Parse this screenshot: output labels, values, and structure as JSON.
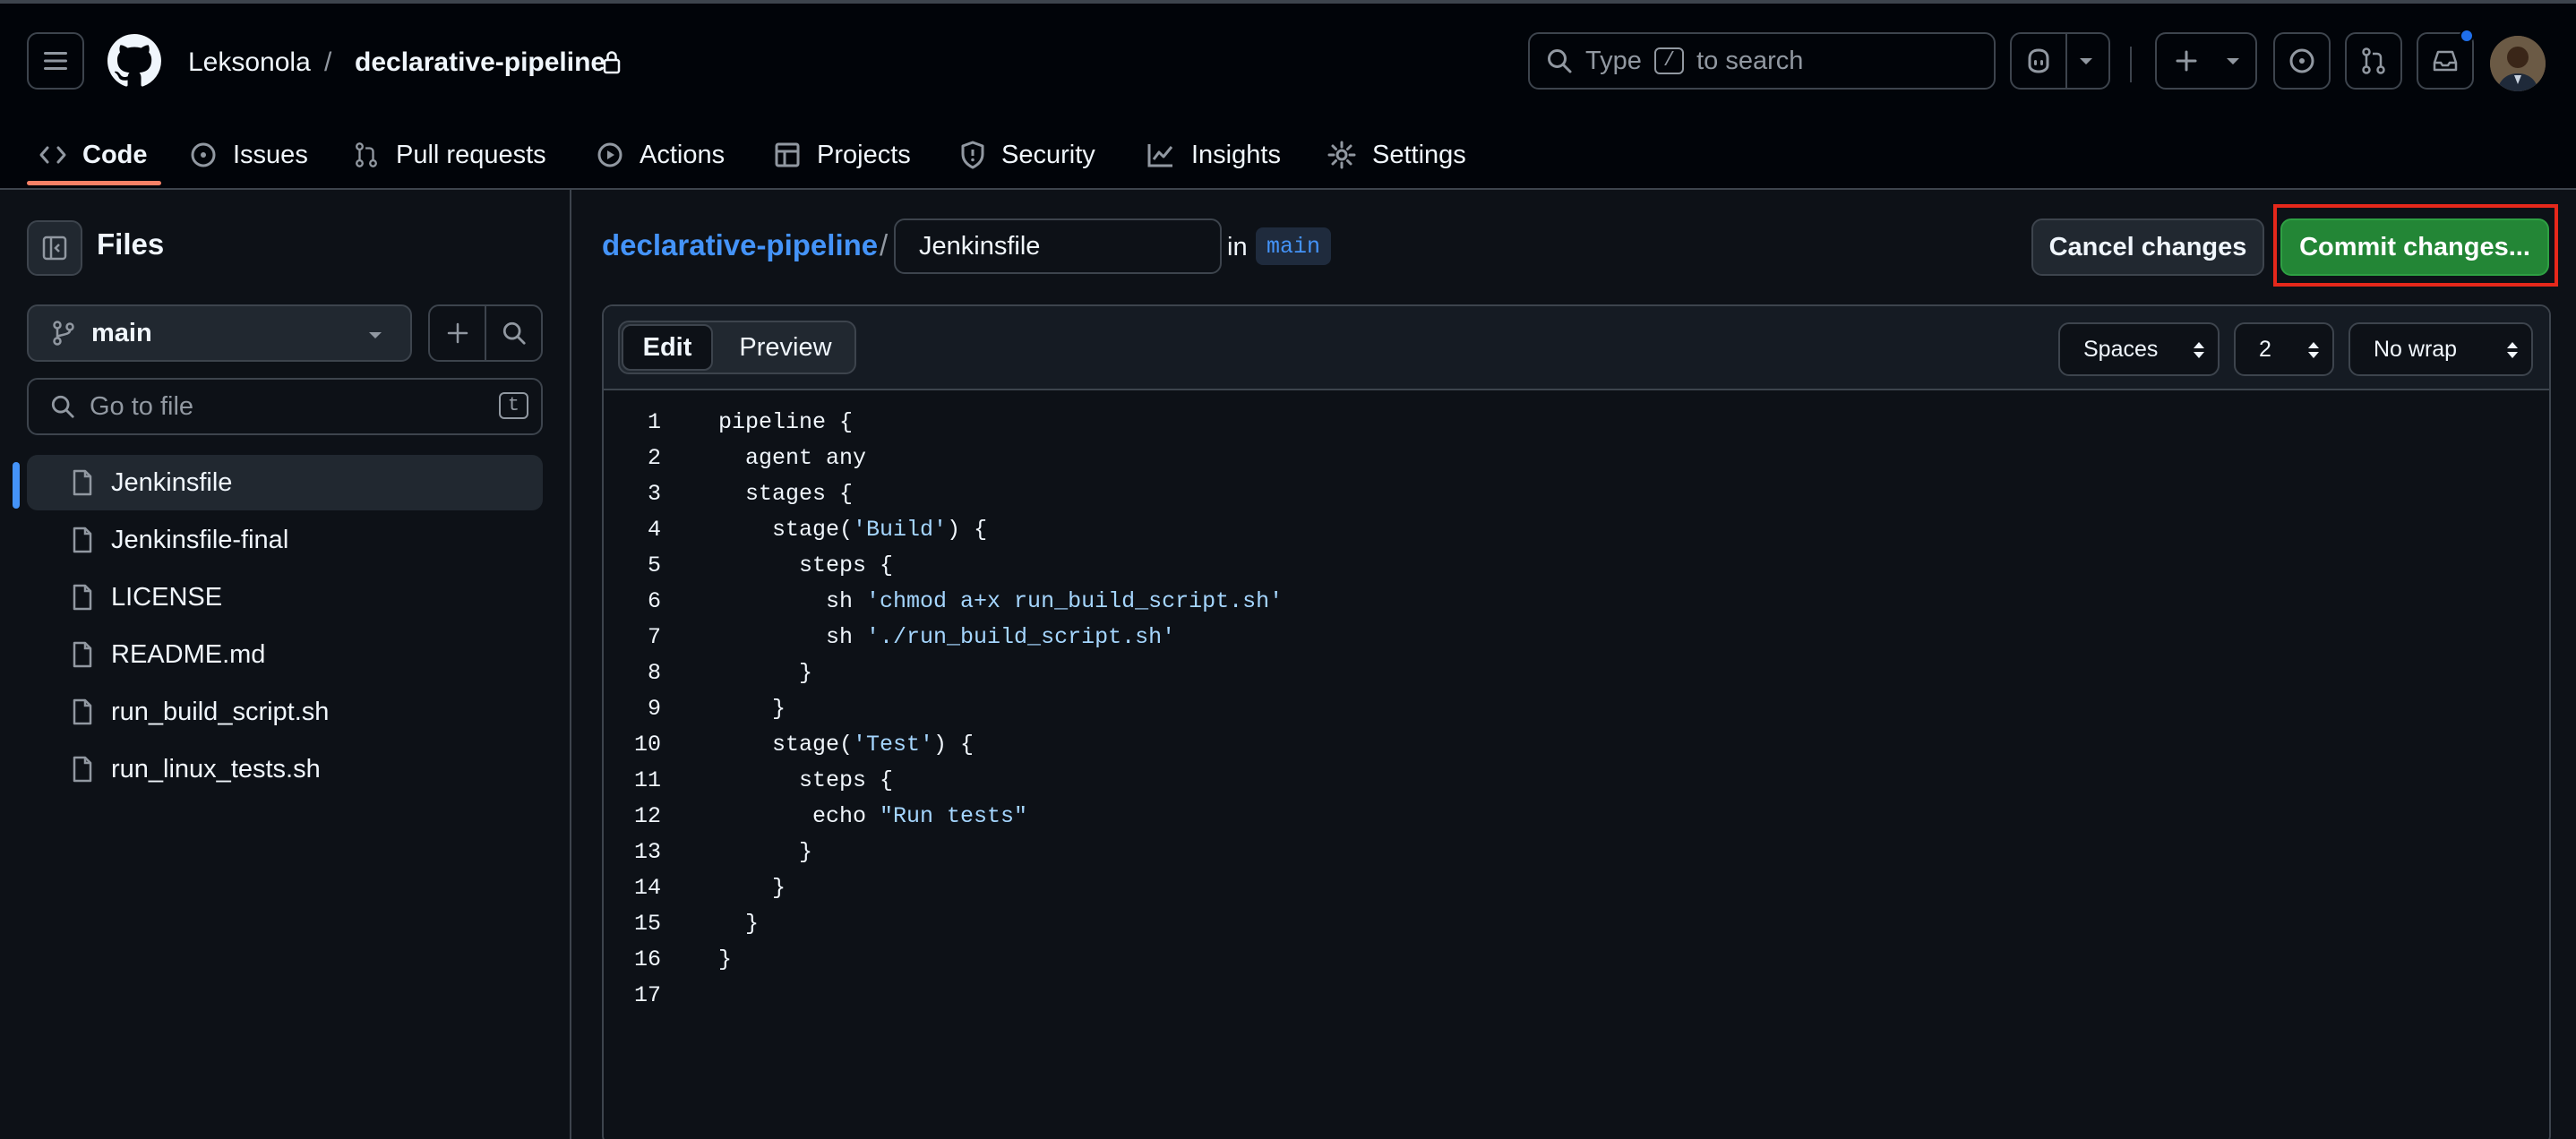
{
  "header": {
    "owner": "Leksonola",
    "separator": "/",
    "repo": "declarative-pipeline",
    "search_prefix": "Type",
    "search_key": "/",
    "search_suffix": "to search"
  },
  "tabs": [
    {
      "label": "Code",
      "icon": "code-icon"
    },
    {
      "label": "Issues",
      "icon": "issue-icon"
    },
    {
      "label": "Pull requests",
      "icon": "pull-request-icon"
    },
    {
      "label": "Actions",
      "icon": "play-icon"
    },
    {
      "label": "Projects",
      "icon": "table-icon"
    },
    {
      "label": "Security",
      "icon": "shield-icon"
    },
    {
      "label": "Insights",
      "icon": "graph-icon"
    },
    {
      "label": "Settings",
      "icon": "gear-icon"
    }
  ],
  "sidebar": {
    "title": "Files",
    "branch": "main",
    "goto_placeholder": "Go to file",
    "goto_key": "t",
    "files": [
      "Jenkinsfile",
      "Jenkinsfile-final",
      "LICENSE",
      "README.md",
      "run_build_script.sh",
      "run_linux_tests.sh"
    ],
    "active_file": "Jenkinsfile"
  },
  "editor_header": {
    "repo_link": "declarative-pipeline",
    "slash": "/",
    "filename": "Jenkinsfile",
    "in_label": "in",
    "branch": "main",
    "cancel_label": "Cancel changes",
    "commit_label": "Commit changes..."
  },
  "editor": {
    "edit_tab": "Edit",
    "preview_tab": "Preview",
    "indent_mode": "Spaces",
    "indent_size": "2",
    "wrap_mode": "No wrap",
    "lines": [
      [
        {
          "t": "pipeline {"
        }
      ],
      [
        {
          "t": "  agent any"
        }
      ],
      [
        {
          "t": "  stages {"
        }
      ],
      [
        {
          "t": "    stage("
        },
        {
          "t": "'Build'",
          "s": true
        },
        {
          "t": ") {"
        }
      ],
      [
        {
          "t": "      steps {"
        }
      ],
      [
        {
          "t": "        sh "
        },
        {
          "t": "'chmod a+x run_build_script.sh'",
          "s": true
        }
      ],
      [
        {
          "t": "        sh "
        },
        {
          "t": "'./run_build_script.sh'",
          "s": true
        }
      ],
      [
        {
          "t": "      }"
        }
      ],
      [
        {
          "t": "    }"
        }
      ],
      [
        {
          "t": "    stage("
        },
        {
          "t": "'Test'",
          "s": true
        },
        {
          "t": ") {"
        }
      ],
      [
        {
          "t": "      steps {"
        }
      ],
      [
        {
          "t": "       echo "
        },
        {
          "t": "\"Run tests\"",
          "s": true
        }
      ],
      [
        {
          "t": "      }"
        }
      ],
      [
        {
          "t": "    }"
        }
      ],
      [
        {
          "t": "  }"
        }
      ],
      [
        {
          "t": "}"
        }
      ],
      [
        {
          "t": ""
        }
      ]
    ]
  },
  "colors": {
    "accent_blue": "#4493f8",
    "commit_green": "#238636",
    "highlight_red": "#e5281b",
    "tab_underline": "#f78166",
    "string": "#a5d6ff"
  }
}
